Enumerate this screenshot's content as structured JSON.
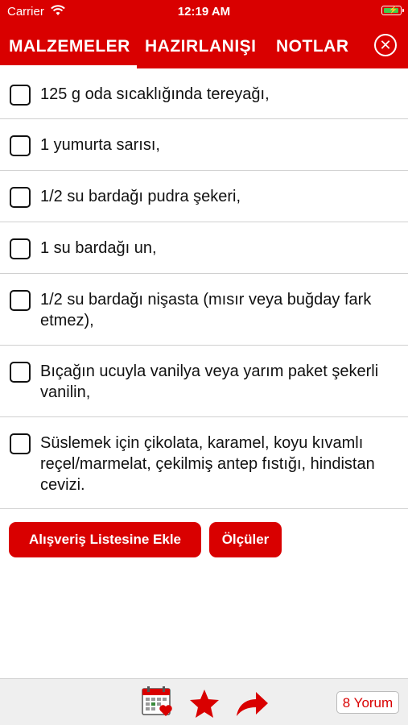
{
  "status_bar": {
    "carrier": "Carrier",
    "time": "12:19 AM"
  },
  "tabs": [
    {
      "label": "MALZEMELER",
      "active": true
    },
    {
      "label": "HAZIRLANIŞI",
      "active": false
    },
    {
      "label": "NOTLAR",
      "active": false
    }
  ],
  "close_glyph": "✕",
  "ingredients": [
    "125 g oda sıcaklığında tereyağı,",
    "1 yumurta sarısı,",
    "1/2 su bardağı pudra şekeri,",
    "1 su bardağı un,",
    "1/2 su bardağı nişasta (mısır veya buğday fark etmez),",
    "Bıçağın ucuyla vanilya veya yarım paket şekerli vanilin,",
    "Süslemek için çikolata, karamel, koyu kıvamlı reçel/marmelat, çekilmiş antep fıstığı, hindistan cevizi."
  ],
  "buttons": {
    "shopping_list": "Alışveriş Listesine Ekle",
    "measures": "Ölçüler"
  },
  "bottom_bar": {
    "comments": "8 Yorum",
    "icons": [
      "calendar-heart-icon",
      "star-icon",
      "share-arrow-icon"
    ]
  },
  "colors": {
    "brand_red": "#d90000",
    "battery_green": "#3ecf4a"
  }
}
